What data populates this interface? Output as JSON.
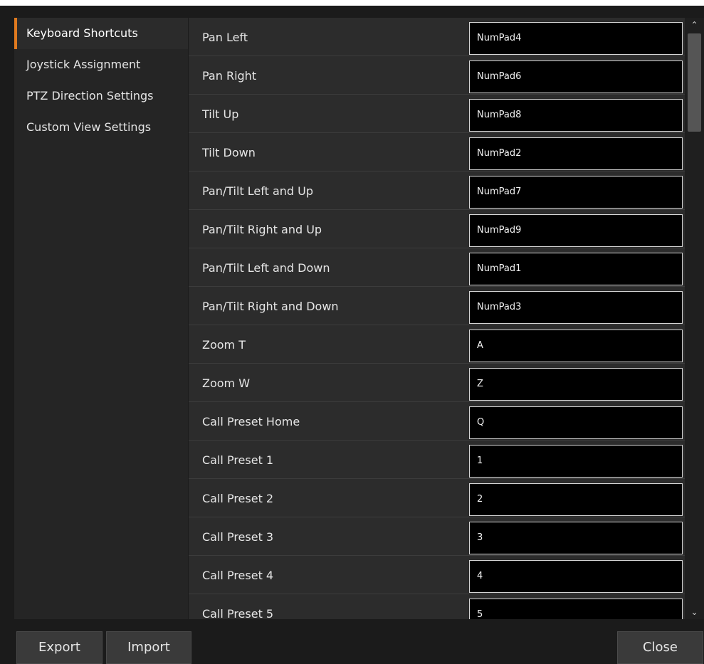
{
  "sidebar": {
    "items": [
      {
        "label": "Keyboard Shortcuts",
        "active": true
      },
      {
        "label": "Joystick Assignment",
        "active": false
      },
      {
        "label": "PTZ Direction Settings",
        "active": false
      },
      {
        "label": "Custom View Settings",
        "active": false
      }
    ]
  },
  "shortcuts": [
    {
      "label": "Pan Left",
      "key": "NumPad4"
    },
    {
      "label": "Pan Right",
      "key": "NumPad6"
    },
    {
      "label": "Tilt Up",
      "key": "NumPad8"
    },
    {
      "label": "Tilt Down",
      "key": "NumPad2"
    },
    {
      "label": "Pan/Tilt Left and Up",
      "key": "NumPad7"
    },
    {
      "label": "Pan/Tilt Right and Up",
      "key": "NumPad9"
    },
    {
      "label": "Pan/Tilt Left and Down",
      "key": "NumPad1"
    },
    {
      "label": "Pan/Tilt Right and Down",
      "key": "NumPad3"
    },
    {
      "label": "Zoom T",
      "key": "A"
    },
    {
      "label": "Zoom W",
      "key": "Z"
    },
    {
      "label": "Call Preset Home",
      "key": "Q"
    },
    {
      "label": "Call Preset 1",
      "key": "1"
    },
    {
      "label": "Call Preset 2",
      "key": "2"
    },
    {
      "label": "Call Preset 3",
      "key": "3"
    },
    {
      "label": "Call Preset 4",
      "key": "4"
    },
    {
      "label": "Call Preset 5",
      "key": "5"
    }
  ],
  "scrollbar": {
    "up_icon": "chevron-up-icon",
    "down_icon": "chevron-down-icon",
    "position": 0.0
  },
  "footer": {
    "export_label": "Export",
    "import_label": "Import",
    "close_label": "Close"
  },
  "colors": {
    "accent": "#e07a1f",
    "background": "#1b1b1b",
    "panel": "#2c2c2c"
  }
}
